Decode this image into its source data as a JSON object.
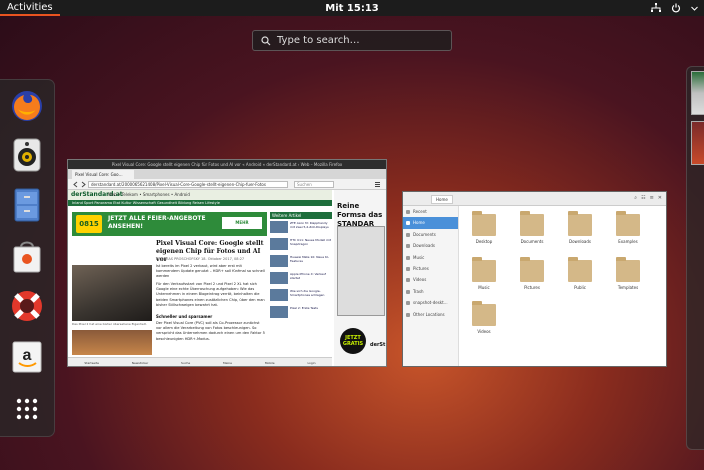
{
  "topbar": {
    "activities_label": "Activities",
    "clock": "Mit 15:13",
    "tray_network_icon": "network-icon",
    "tray_power_icon": "power-icon"
  },
  "search": {
    "placeholder": "Type to search…"
  },
  "dash": {
    "apps": [
      {
        "name": "Firefox",
        "icon": "firefox-icon"
      },
      {
        "name": "Rhythmbox",
        "icon": "speaker-icon"
      },
      {
        "name": "Files",
        "icon": "file-cabinet-icon"
      },
      {
        "name": "Ubuntu Software",
        "icon": "shopping-bag-icon"
      },
      {
        "name": "Help",
        "icon": "lifebuoy-icon"
      },
      {
        "name": "Amazon",
        "icon": "amazon-icon"
      },
      {
        "name": "Show Applications",
        "icon": "app-grid-icon"
      }
    ]
  },
  "firefox": {
    "title": "Pixel Visual Core: Google stellt eigenen Chip für Fotos und AI vor « Android « derStandard.at › Web – Mozilla Firefox",
    "tab_label": "Pixel Visual Core: Goo…",
    "url": "derstandard.at/2000065621408/Pixel-Visual-Core-Google-stellt-eigenen-Chip-fuer-Fotos",
    "search_placeholder": "Suchen",
    "site": {
      "logo": "derStandard.at",
      "nav": "Web  •  Telekom  •  Smartphones  •  Android",
      "subnav": "Inland  Sport  Panorama  Etat  Kultur  Wissenschaft  Gesundheit  Bildung  Reisen  Lifestyle",
      "banner_logo": "0815",
      "banner_text": "JETZT ALLE FEIER-ANGEBOTE ANSEHEN!",
      "banner_button": "MEHR",
      "headline": "Pixel Visual Core: Google stellt eigenen Chip für Fotos und AI vor",
      "meta": "ANDREAS PROSCHOFSKY  18. Oktober 2017, 08:27",
      "lead": "Ist bereits im Pixel 2 verbaut, wird aber erst mit kommendem Update genutzt – HDR+ soll fünfmal so schnell werden",
      "body": "Für den Verkaufsstart von Pixel 2 und Pixel 2 XL hat sich Google eine echte Überraschung aufgehoben: Wie das Unternehmen in einem Blogeintrag verrät, beinhalten die beiden Smartphones einen zusätzlichen Chip, über den man bisher Stillschweigen bewahrt hat.",
      "caption": "Das Pixel 2 hat eine bisher übersehene Eigenheit.",
      "subhead": "Schneller und sparsamer",
      "body2": "Der Pixel Visual Core (PVC) soll als Co-Prozessor zunächst vor allem die Verarbeitung von Fotos beschleunigen. So verspricht das Unternehmen dadurch einen um den Faktor 5 beschleunigten HDR+-Modus.",
      "sidebar_head": "Weitere Artikel",
      "sidebar_items": [
        "ZTE Axon M: Klapphandy mit zwei 5,2-Zoll-Displays",
        "HTC U11: Neues Modell mit Snapdragon",
        "Huawei Mate 10: Neue KI-Features",
        "Apple iPhone X: Verkauf startet",
        "Wie sich die Google-Smartphones schlagen",
        "Pixel 2: Erste Tests"
      ],
      "ad_title": "Reine Formsa das STANDAR",
      "ad_badge": "JETZT GRATIS",
      "ad_logo": "derSt",
      "status_items": [
        "Startseite",
        "Newsticker",
        "Suche",
        "Meine",
        "Mobile",
        "Login"
      ]
    }
  },
  "files": {
    "path": "Home",
    "sidebar": [
      "Recent",
      "Home",
      "Documents",
      "Downloads",
      "Music",
      "Pictures",
      "Videos",
      "Trash",
      "snapshot-deskt…",
      "Other Locations"
    ],
    "folders": [
      "Desktop",
      "Documents",
      "Downloads",
      "Examples",
      "Music",
      "Pictures",
      "Public",
      "Templates",
      "Videos"
    ]
  }
}
